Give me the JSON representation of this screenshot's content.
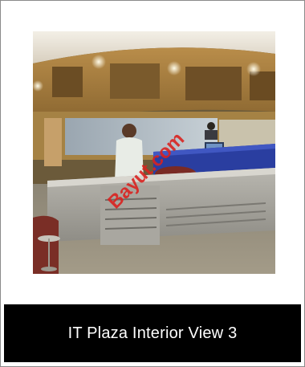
{
  "photo": {
    "alt": "IT Plaza Interior View 3",
    "watermark_text": "Bayut.com",
    "watermark_color": "#d9221f"
  },
  "caption": {
    "title": "IT Plaza Interior View 3",
    "bar_color": "#000000",
    "text_color": "#ffffff"
  }
}
